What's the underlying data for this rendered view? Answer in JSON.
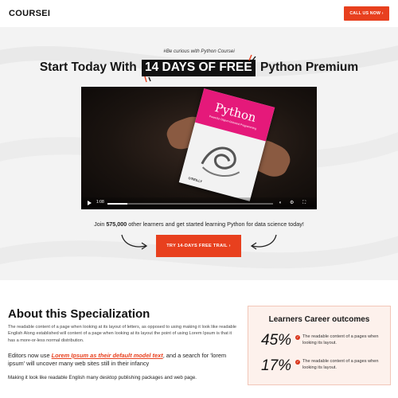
{
  "header": {
    "logo": "COURSEI",
    "cta_label": "CALL US NOW ›"
  },
  "hero": {
    "tagline": "#Be curious with Python Coursei",
    "headline_before": "Start Today With",
    "headline_highlight": "14 DAYS OF FREE",
    "headline_after": "Python Premium",
    "video": {
      "book_title": "Python",
      "book_subtitle": "Powerful Object-Oriented Programming",
      "book_publisher": "O'REILLY",
      "current_time": "1:08",
      "progress_fraction": 0.12,
      "controls": [
        "volume-icon",
        "settings-icon",
        "fullscreen-icon"
      ]
    },
    "join_before": "Join ",
    "join_count": "575,000",
    "join_after": " other learners and get started learning Python for data science today!",
    "trail_button": "TRY 14-DAYS FREE TRAIL  ›"
  },
  "about": {
    "title": "About this Specialization",
    "para1": "The readable content of a page when looking at its layout of letters, as opposed to using making it look like readable English Along established will content of a page when looking at its layout the point of using Lorem Ipsum is that it has a more-or-less normal distribution.",
    "para2_before": "Editors now use ",
    "para2_emphasis": "Lorem Ipsum as their default model text",
    "para2_after": ", and a search for 'lorem ipsum' will uncover many web sites still in their infancy",
    "para3": "Making it look like readable English many desktop publishing packages and web page."
  },
  "career": {
    "title": "Learners Career outcomes",
    "stats": [
      {
        "value": "45%",
        "text": "The readable content of a pages when looking its layout."
      },
      {
        "value": "17%",
        "text": "The readable content of a pages when looking its layout."
      }
    ]
  },
  "colors": {
    "accent": "#e8401e",
    "hero_bg": "#f3f3f3",
    "career_bg": "#fdf1ec"
  }
}
